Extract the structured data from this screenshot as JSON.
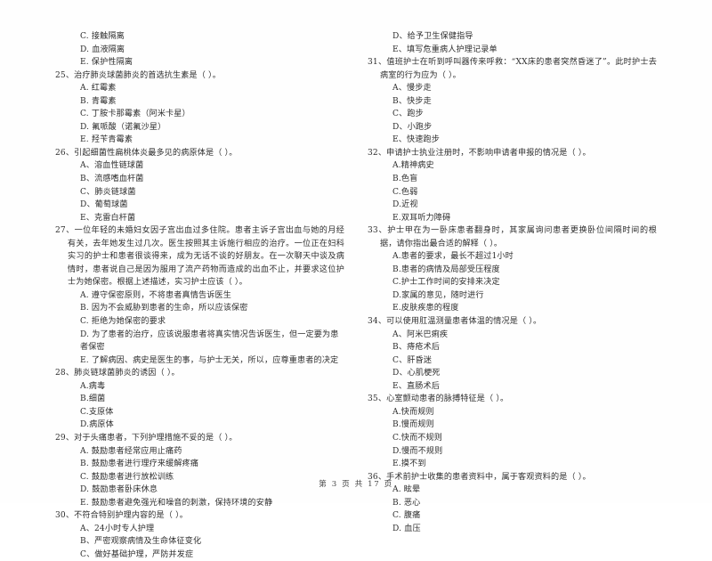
{
  "document": {
    "footer": "第 3 页 共 17 页"
  },
  "left_column": {
    "leading_options": [
      "C. 接触隔离",
      "D. 血液隔离",
      "E. 保护性隔离"
    ],
    "questions": [
      {
        "number": "25",
        "stem": "25、治疗肺炎球菌肺炎的首选抗生素是（     ）。",
        "options": [
          "A. 红霉素",
          "B. 青霉素",
          "C. 丁胺卡那霉素（阿米卡星）",
          "D. 氟哌酸（诺氟沙星）",
          "E. 羟苄青霉素"
        ]
      },
      {
        "number": "26",
        "stem": "26、引起细菌性扁桃体炎最多见的病原体是（     ）。",
        "options": [
          "A、溶血性链球菌",
          "B、流感嗜血杆菌",
          "C、肺炎链球菌",
          "D、葡萄球菌",
          "E、克雷白杆菌"
        ]
      },
      {
        "number": "27",
        "stem": "27、一位年轻的未婚妇女因子宫出血过多住院。患者主诉子宫出血与她的月经有关，去年她发生过几次。医生按照其主诉施行相应的治疗。一位正在妇科实习的护士和患者很谈得来，成为无话不谈的好朋友。在一次聊天中谈及病情时，患者说自己是因为服用了流产药物而造成的出血不止，并要求这位护士为她保密。根据上述描述，实习护士应该（     ）。",
        "options": [
          "A. 遵守保密原则，不将患者真情告诉医生",
          "B. 因为不会威胁到患者的生命，所以应该保密",
          "C. 拒绝为她保密的要求",
          "D. 为了患者的治疗，应该说服患者将真实情况告诉医生，但一定要为患者保密",
          "E. 了解病因、病史是医生的事，与护士无关，所以，应尊重患者的决定"
        ]
      },
      {
        "number": "28",
        "stem": "28、肺炎链球菌肺炎的诱因（     ）。",
        "options": [
          "A.病毒",
          "B.细菌",
          "C.支原体",
          "D.病原体"
        ]
      },
      {
        "number": "29",
        "stem": "29、对于头痛患者，下列护理措施不妥的是（     ）。",
        "options": [
          "A. 鼓励患者经常应用止痛药",
          "B. 鼓励患者进行理疗来缓解疼痛",
          "C. 鼓励患者进行放松训练",
          "D. 鼓励患者卧床休息",
          "E. 鼓励患者避免强光和噪音的刺激，保持环境的安静"
        ]
      },
      {
        "number": "30",
        "stem": "30、不符合特别护理内容的是（     ）。",
        "options": [
          "A、24小时专人护理",
          "B、严密观察病情及生命体征变化",
          "C、做好基础护理，严防并发症"
        ]
      }
    ]
  },
  "right_column": {
    "leading_options": [
      "D、给予卫生保健指导",
      "E、填写危重病人护理记录单"
    ],
    "questions": [
      {
        "number": "31",
        "stem": "31、值班护士在听到呼叫器传来呼救：“XX床的患者突然昏迷了”。此时护士去病室的行为应为（     ）。",
        "options": [
          "A、慢步走",
          "B、快步走",
          "C、跑步",
          "D、小跑步",
          "E、快速跑步"
        ]
      },
      {
        "number": "32",
        "stem": "32、申请护士执业注册时，不影响申请者申报的情况是（     ）。",
        "options": [
          "A.精神病史",
          "B.色盲",
          "C.色弱",
          "D.近视",
          "E.双耳听力障碍"
        ]
      },
      {
        "number": "33",
        "stem": "33、护士甲在为一卧床患者翻身时，其家属询问患者更换卧位间隔时间的根据，请你指出最合适的解释（     ）。",
        "options": [
          "A.患者的要求，最长不超过1小时",
          "B.患者的病情及局部受压程度",
          "C.护士工作时间的安排来决定",
          "D.家属的意见，随时进行",
          "E.皮肤疾患的程度"
        ]
      },
      {
        "number": "34",
        "stem": "34、可以使用肛温测量患者体温的情况是（     ）。",
        "options": [
          "A、阿米巴痢疾",
          "B、痔疮术后",
          "C、肝昏迷",
          "D、心肌梗死",
          "E、直肠术后"
        ]
      },
      {
        "number": "35",
        "stem": "35、心室颤动患者的脉搏特征是（     ）。",
        "options": [
          "A.快而规则",
          "B.慢而规则",
          "C.快而不规则",
          "D.慢而不规则",
          "E.摸不到"
        ]
      },
      {
        "number": "36",
        "stem": "36、手术前护士收集的患者资料中，属于客观资料的是（     ）。",
        "options": [
          "A. 眩晕",
          "B. 恶心",
          "C. 腹痛",
          "D. 血压"
        ]
      }
    ]
  }
}
